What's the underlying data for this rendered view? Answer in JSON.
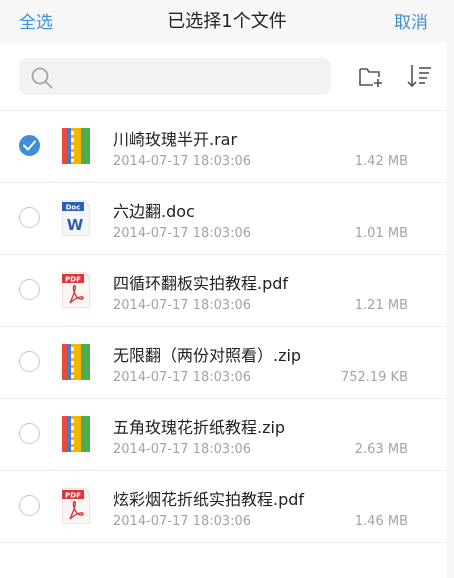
{
  "header": {
    "select_all": "全选",
    "title": "已选择1个文件",
    "cancel": "取消"
  },
  "search": {
    "placeholder": ""
  },
  "files": [
    {
      "name": "川崎玫瑰半开.rar",
      "date": "2014-07-17 18:03:06",
      "size": "1.42 MB",
      "type": "archive",
      "selected": true
    },
    {
      "name": "六边翻.doc",
      "date": "2014-07-17 18:03:06",
      "size": "1.01 MB",
      "type": "doc",
      "selected": false
    },
    {
      "name": "四循环翻板实拍教程.pdf",
      "date": "2014-07-17 18:03:06",
      "size": "1.21 MB",
      "type": "pdf",
      "selected": false
    },
    {
      "name": "无限翻（两份对照看）.zip",
      "date": "2014-07-17 18:03:06",
      "size": "752.19 KB",
      "type": "archive",
      "selected": false
    },
    {
      "name": "五角玫瑰花折纸教程.zip",
      "date": "2014-07-17 18:03:06",
      "size": "2.63 MB",
      "type": "archive",
      "selected": false
    },
    {
      "name": "炫彩烟花折纸实拍教程.pdf",
      "date": "2014-07-17 18:03:06",
      "size": "1.46 MB",
      "type": "pdf",
      "selected": false
    }
  ],
  "icons": {
    "doc_label": "Doc",
    "doc_letter": "W",
    "pdf_label": "PDF"
  },
  "colors": {
    "accent": "#3d8fd6",
    "pdf_red": "#d9363e",
    "doc_blue": "#2b5fb4"
  }
}
